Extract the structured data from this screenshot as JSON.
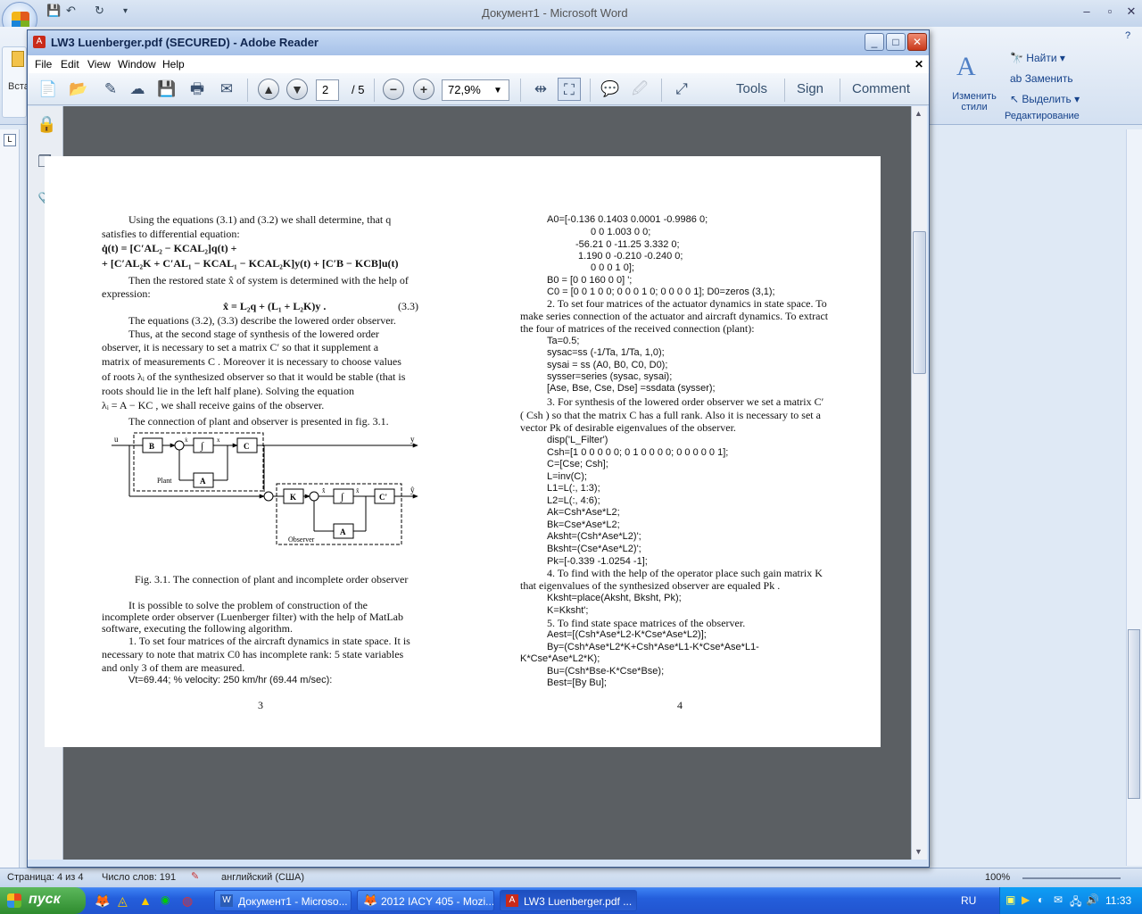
{
  "word": {
    "title": "Документ1 - Microsoft Word",
    "ribbon": {
      "change_styles": "Изменить стили",
      "find": "Найти",
      "replace": "Заменить",
      "select": "Выделить",
      "editing_group": "Редактирование",
      "insert_partial": "Вста"
    },
    "status": {
      "page": "Страница: 4 из 4",
      "words": "Число слов: 191",
      "language": "английский (США)",
      "zoom": "100%"
    }
  },
  "reader": {
    "title": "LW3 Luenberger.pdf (SECURED) - Adobe Reader",
    "menu": [
      "File",
      "Edit",
      "View",
      "Window",
      "Help"
    ],
    "page_current": "2",
    "page_total": "/ 5",
    "zoom": "72,9%",
    "tools": "Tools",
    "sign": "Sign",
    "comment": "Comment"
  },
  "pdf": {
    "left_col": {
      "p1a": "Using the equations (3.1) and (3.2) we shall determine, that  q",
      "p1b": "satisfies to differential equation:",
      "eq1": "q̇(t) = [C′AL₂ − KCAL₂]q(t) +",
      "eq2": "+ [C′AL₂K + C′AL₁ − KCAL₁ − KCAL₂K]y(t) + [C′B − KCB]u(t)",
      "p2a": "Then the restored state  x̂  of system is determined with the help of",
      "p2b": "expression:",
      "eq3": "x̂ = L₂q + (L₁ + L₂K)y .",
      "eq3_num": "(3.3)",
      "p3": "The equations (3.2), (3.3) describe the lowered order observer.",
      "p4a": "Thus, at the second stage of synthesis of the lowered order",
      "p4b": "observer, it is necessary to set a matrix  C′  so that it supplement a",
      "p4c": "matrix of measurements  C . Moreover it is necessary to choose values",
      "p4d": "of roots  λᵢ  of the synthesized observer so that it would be stable (that is",
      "p4e": "roots  should  lie  in  the  left  half  plane).  Solving  the  equation",
      "p4f": "λᵢ = A − KC , we shall receive gains of the observer.",
      "p5": "The connection of plant and observer is presented in fig. 3.1.",
      "fig_caption": "Fig. 3.1. The connection of plant and incomplete order observer",
      "p6a": "It  is  possible  to  solve  the  problem  of  construction  of  the",
      "p6b": "incomplete order observer (Luenberger filter) with the help of MatLab",
      "p6c": "software, executing the following algorithm.",
      "p7a": "1. To set four matrices of the aircraft dynamics in state space. It is",
      "p7b": "necessary to note that matrix  C0  has incomplete rank: 5 state variables",
      "p7c": "and only 3 of them are measured.",
      "vt": "Vt=69.44; % velocity: 250 km/hr (69.44 m/sec):",
      "page_num": "3"
    },
    "fig": {
      "u": "u",
      "y": "y",
      "yhat": "ŷ",
      "B": "B",
      "int1": "∫",
      "C": "C",
      "A1": "A",
      "plant": "Plant",
      "K": "K",
      "int2": "∫",
      "C2": "C'",
      "A2": "A",
      "observer": "Observer",
      "xdot": "ẋ",
      "x": "x",
      "xhatdot": "x̂̇",
      "xhat": "x̂"
    },
    "right_col": {
      "a0_1": "A0=[-0.136  0.1403     0.0001     -0.9986    0;",
      "a0_2": "0            0          1.003           0          0;",
      "a0_3": "-56.21        0       -11.25         3.332    0;",
      "a0_4": "1.190        0         -0.210        -0.240    0;",
      "a0_5": "0            0               0                1        0];",
      "b0": "B0 = [0  0  160  0  0] ';",
      "c0": "C0 = [0  0  1  0  0;  0  0  0  1  0;  0  0  0  0  1]; D0=zeros (3,1);",
      "s2a": "2. To set four matrices of the actuator dynamics in state space. To",
      "s2b": "make series connection of the actuator and aircraft dynamics. To extract",
      "s2c": "the four of matrices of the received connection (plant):",
      "c1": "Ta=0.5;",
      "c2": "sysac=ss (-1/Ta, 1/Ta, 1,0);",
      "c3": "sysai = ss (A0, B0, C0, D0);",
      "c4": "sysser=series (sysac, sysai);",
      "c5": "[Ase, Bse, Cse, Dse] =ssdata (sysser);",
      "s3a": "3. For synthesis of the lowered order observer we set a matrix  C′",
      "s3b": "( Csh ) so that the matrix  C  has a full rank. Also it is necessary to set a",
      "s3c": "vector  Pk  of desirable eigenvalues of the observer.",
      "d1": "disp('L_Filter')",
      "d2": "Csh=[1  0  0  0  0  0;  0  1  0  0  0  0;  0  0  0  0  0  1];",
      "d3": "C=[Cse; Csh];",
      "d4": "L=inv(C);",
      "d5": "L1=L(:, 1:3);",
      "d6": "L2=L(:, 4:6);",
      "d7": "Ak=Csh*Ase*L2;",
      "d8": "Bk=Cse*Ase*L2;",
      "d9": "Aksht=(Csh*Ase*L2)';",
      "d10": "Bksht=(Cse*Ase*L2)';",
      "d11": "Pk=[-0.339   -1.0254     -1];",
      "s4a": "4. To find with the help of the operator  place  such gain matrix  K",
      "s4b": "that eigenvalues of the synthesized observer are equaled  Pk .",
      "e1": "Kksht=place(Aksht, Bksht, Pk);",
      "e2": "K=Kksht';",
      "s5": "5. To find state space matrices of the observer.",
      "f1": "Aest=[(Csh*Ase*L2-K*Cse*Ase*L2)];",
      "f2a": "By=(Csh*Ase*L2*K+Csh*Ase*L1-K*Cse*Ase*L1-",
      "f2b": "K*Cse*Ase*L2*K);",
      "f3": "Bu=(Csh*Bse-K*Cse*Bse);",
      "f4": "Best=[By Bu];",
      "page_num": "4"
    }
  },
  "taskbar": {
    "start": "пуск",
    "tasks": [
      "Документ1 - Microso...",
      "2012 IACY 405 - Mozi...",
      "LW3 Luenberger.pdf ..."
    ],
    "lang": "RU",
    "time": "11:33"
  }
}
